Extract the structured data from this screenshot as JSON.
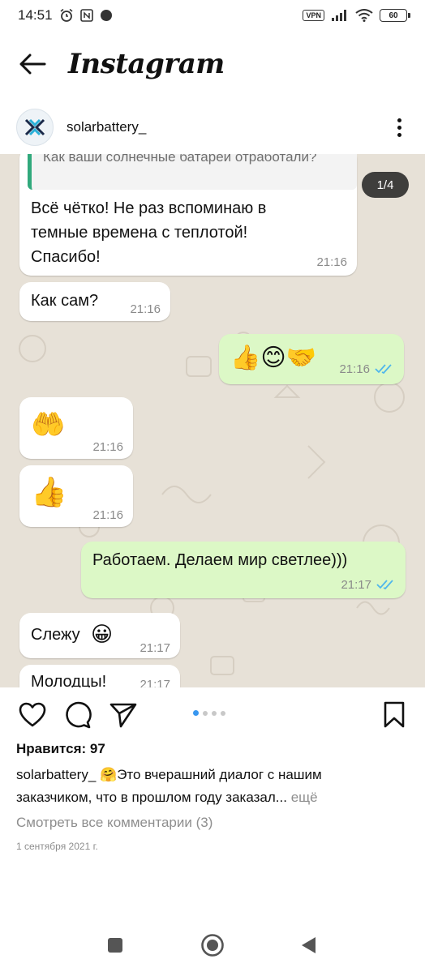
{
  "status_bar": {
    "time": "14:51",
    "vpn_label": "VPN",
    "battery_level": "60"
  },
  "header": {
    "logo": "Instagram"
  },
  "post": {
    "username": "solarbattery_",
    "image_counter": "1/4",
    "chat": {
      "quote_text": "Как ваши солнечные батареи отработали?",
      "msg1_line1": "Всё чётко! Не раз вспоминаю в",
      "msg1_line2": "темные времена с теплотой!",
      "msg1_line3": "Спасибо!",
      "msg1_time": "21:16",
      "msg2_text": "Как сам?",
      "msg2_time": "21:16",
      "msg3_emoji": "👍😊🤝",
      "msg3_time": "21:16",
      "msg4_emoji": "🤲",
      "msg4_time": "21:16",
      "msg5_emoji": "👍",
      "msg5_time": "21:16",
      "msg6_text": "Работаем. Делаем мир светлее)))",
      "msg6_time": "21:17",
      "msg7_text": "Слежу",
      "msg7_emoji": "😀",
      "msg7_time": "21:17",
      "msg8_text": "Молодцы!",
      "msg8_time": "21:17"
    },
    "carousel": {
      "total": 4,
      "current": 1
    },
    "likes_text": "Нравится: 97",
    "caption_user": "solarbattery_",
    "caption_emoji": "🤗",
    "caption_text": "Это вчерашний диалог с нашим заказчиком, что в прошлом году заказал...",
    "caption_more": "ещё",
    "view_comments": "Смотреть все комментарии (3)",
    "date": "1 сентября 2021 г."
  },
  "colors": {
    "chat_wallpaper": "#e7e1d7",
    "incoming_bubble": "#ffffff",
    "outgoing_bubble": "#dcf8c6",
    "quote_accent": "#31a97c",
    "read_ticks": "#4fb6ec",
    "pager_active": "#3897f0"
  },
  "icons": {
    "back": "arrow-left-icon",
    "more": "more-vertical-icon",
    "like": "heart-icon",
    "comment": "comment-icon",
    "share": "send-icon",
    "save": "bookmark-icon",
    "nav_recent": "square-icon",
    "nav_home": "circle-icon",
    "nav_back": "triangle-back-icon"
  }
}
